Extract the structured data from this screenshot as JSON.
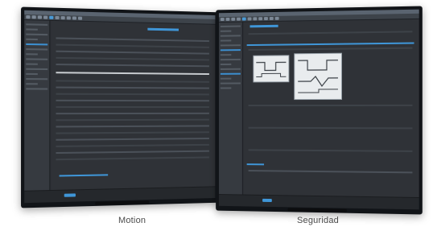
{
  "captions": {
    "left": "Motion",
    "right": "Seguridad"
  },
  "colors": {
    "accent": "#3f96d8",
    "screen_bg": "#2b2e33",
    "bezel": "#111418",
    "caption_text": "#4a4a4a"
  },
  "icons": {
    "toolbar": "toolbar-button-icon"
  }
}
